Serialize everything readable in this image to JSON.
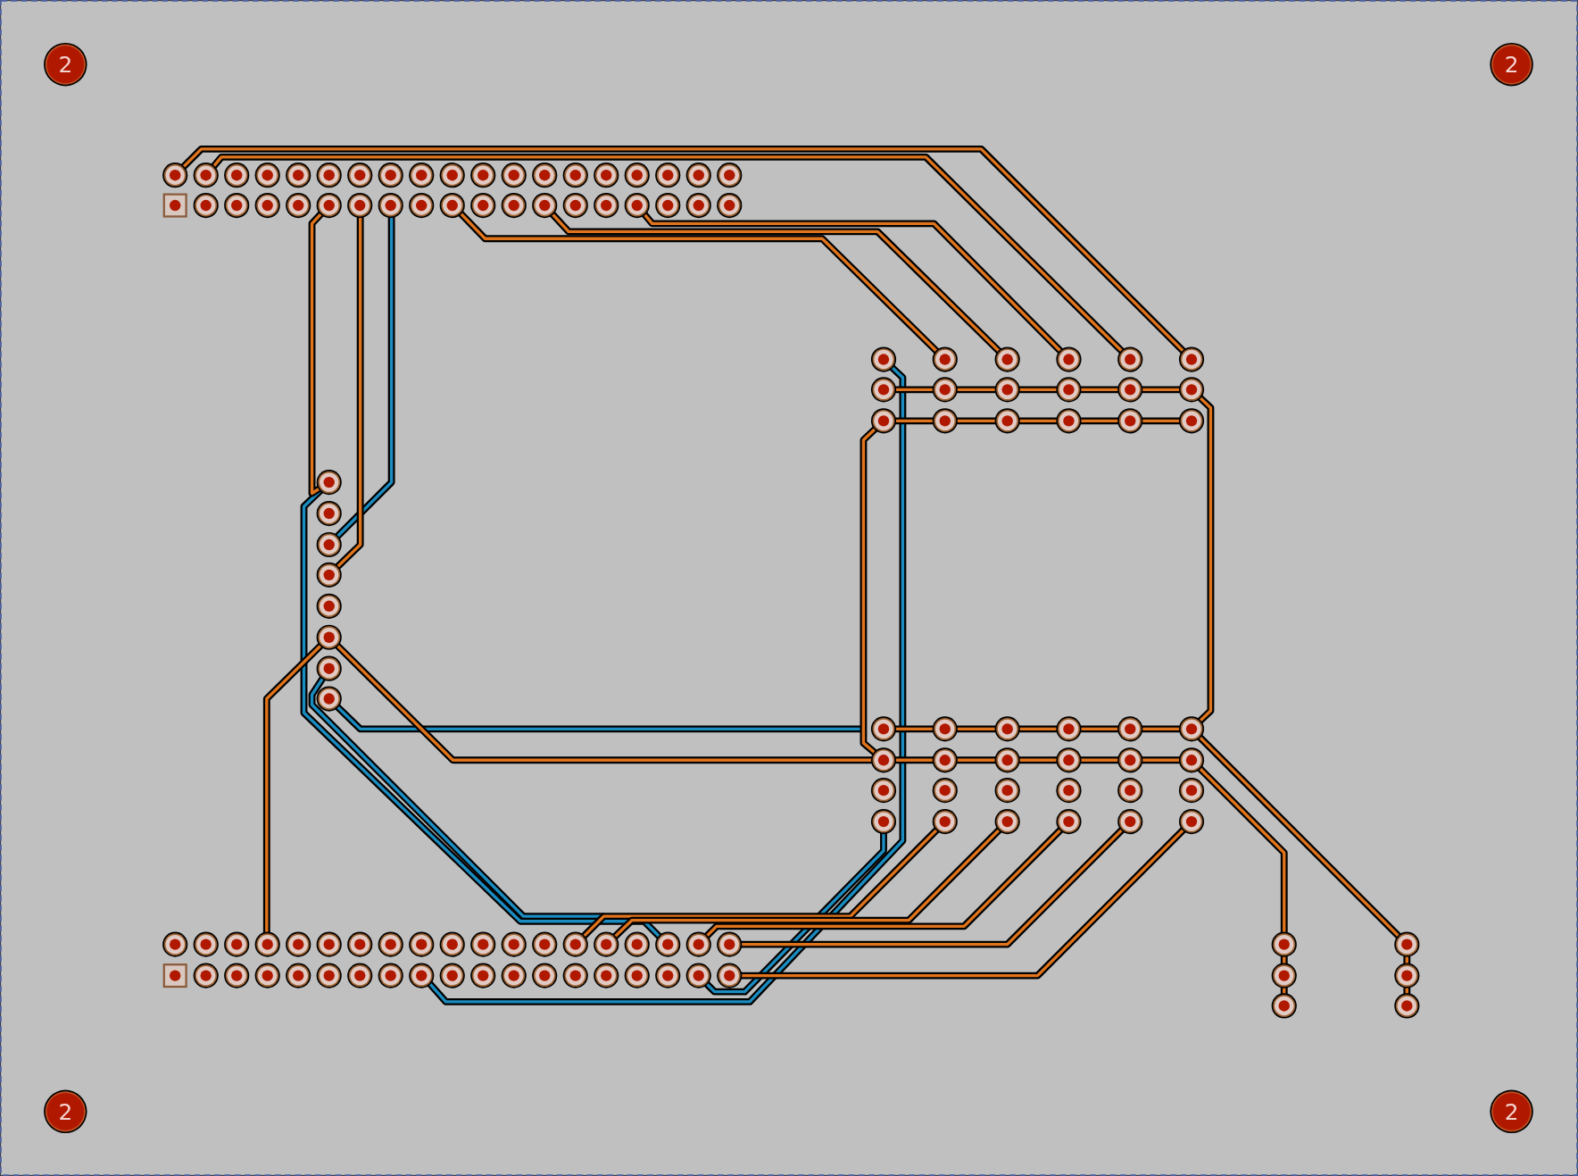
{
  "board": {
    "mounting_holes": [
      {
        "label": "2"
      },
      {
        "label": "2"
      },
      {
        "label": "2"
      },
      {
        "label": "2"
      }
    ]
  }
}
